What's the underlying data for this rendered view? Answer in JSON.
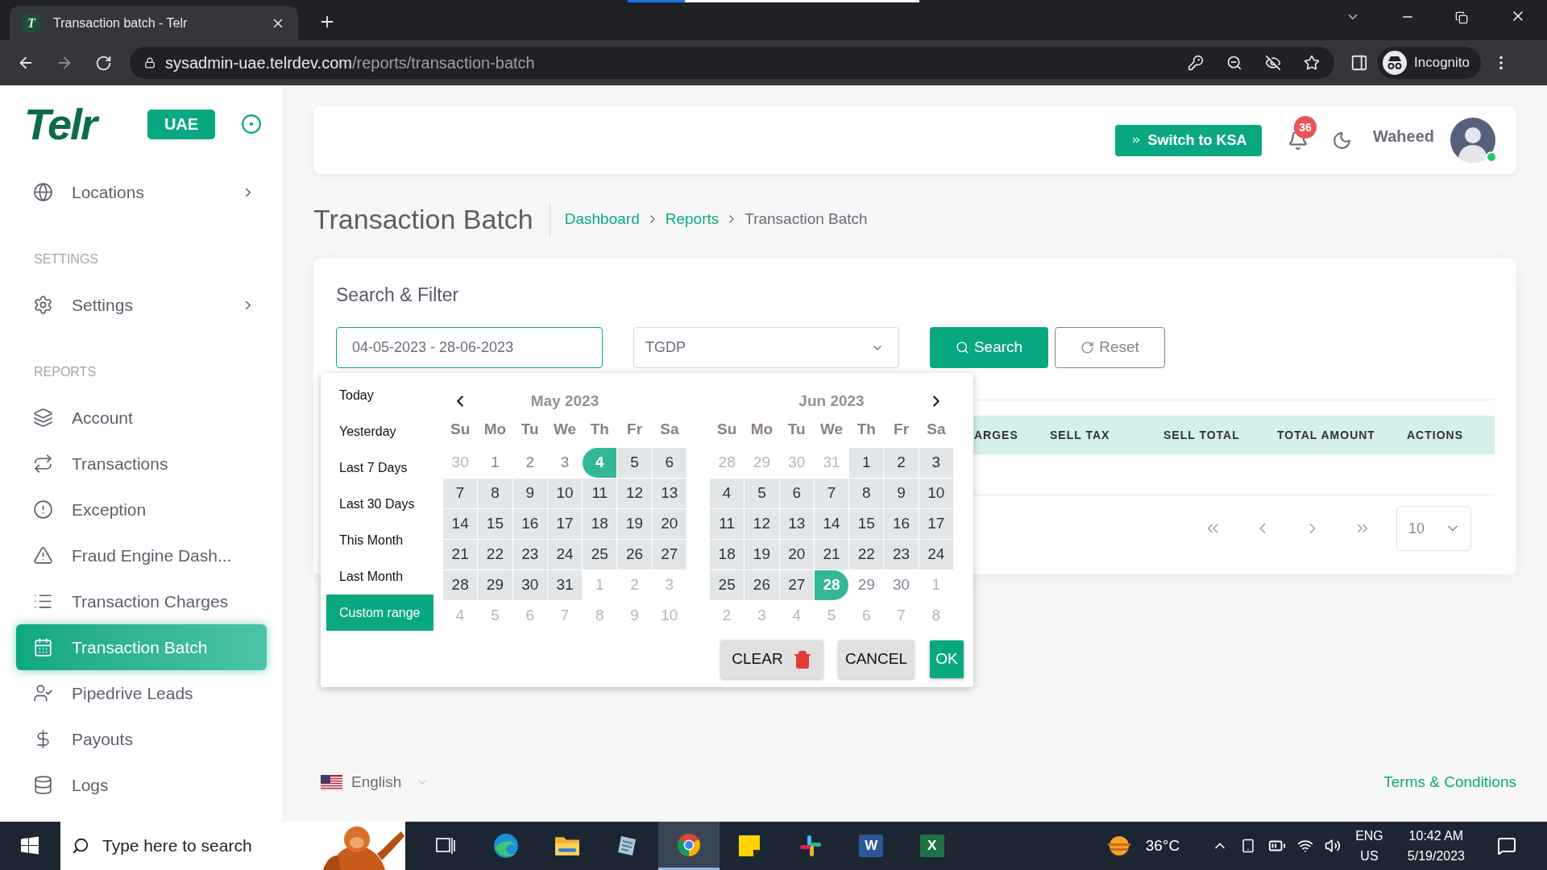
{
  "browser": {
    "tab": {
      "favicon": "T",
      "title": "Transaction batch - Telr"
    },
    "url": {
      "host": "sysadmin-uae.telrdev.com",
      "path": "/reports/transaction-batch"
    },
    "profile": "Incognito"
  },
  "sidebar": {
    "logo": "Telr",
    "region_badge": "UAE",
    "sections": [
      {
        "items": [
          {
            "label": "Locations",
            "has_submenu": true,
            "selected": false
          }
        ]
      },
      {
        "title": "SETTINGS",
        "items": [
          {
            "label": "Settings",
            "has_submenu": true,
            "selected": false
          }
        ]
      },
      {
        "title": "REPORTS",
        "items": [
          {
            "label": "Account",
            "has_submenu": false,
            "selected": false
          },
          {
            "label": "Transactions",
            "has_submenu": false,
            "selected": false
          },
          {
            "label": "Exception",
            "has_submenu": false,
            "selected": false
          },
          {
            "label": "Fraud Engine Dash...",
            "has_submenu": false,
            "selected": false
          },
          {
            "label": "Transaction Charges",
            "has_submenu": false,
            "selected": false
          },
          {
            "label": "Transaction Batch",
            "has_submenu": false,
            "selected": true
          },
          {
            "label": "Pipedrive Leads",
            "has_submenu": false,
            "selected": false
          },
          {
            "label": "Payouts",
            "has_submenu": false,
            "selected": false
          },
          {
            "label": "Logs",
            "has_submenu": false,
            "selected": false
          }
        ]
      }
    ]
  },
  "header": {
    "switch_button": "Switch to KSA",
    "notifications": "36",
    "user": {
      "name": "Waheed",
      "online": true
    }
  },
  "page": {
    "title": "Transaction Batch",
    "breadcrumbs": [
      {
        "label": "Dashboard",
        "current": false
      },
      {
        "label": "Reports",
        "current": false
      },
      {
        "label": "Transaction Batch",
        "current": true
      }
    ]
  },
  "filter": {
    "title": "Search & Filter",
    "date_range": {
      "value": "04-05-2023 - 28-06-2023",
      "focused": true
    },
    "merchant_select": {
      "value": "TGDP"
    },
    "buttons": [
      {
        "label": "Search",
        "kind": "primary"
      },
      {
        "label": "Reset",
        "kind": "secondary"
      }
    ]
  },
  "date_picker": {
    "ranges": [
      {
        "label": "Today",
        "selected": false
      },
      {
        "label": "Yesterday",
        "selected": false
      },
      {
        "label": "Last 7 Days",
        "selected": false
      },
      {
        "label": "Last 30 Days",
        "selected": false
      },
      {
        "label": "This Month",
        "selected": false
      },
      {
        "label": "Last Month",
        "selected": false
      },
      {
        "label": "Custom range",
        "selected": true
      }
    ],
    "months": [
      {
        "title": "May 2023",
        "weekdays": [
          "Su",
          "Mo",
          "Tu",
          "We",
          "Th",
          "Fr",
          "Sa"
        ],
        "days": [
          {
            "day": "30",
            "kind": "off"
          },
          {
            "day": "1",
            "kind": "normal"
          },
          {
            "day": "2",
            "kind": "normal"
          },
          {
            "day": "3",
            "kind": "normal"
          },
          {
            "day": "4",
            "kind": "start"
          },
          {
            "day": "5",
            "kind": "in_range"
          },
          {
            "day": "6",
            "kind": "in_range"
          },
          {
            "day": "7",
            "kind": "in_range"
          },
          {
            "day": "8",
            "kind": "in_range"
          },
          {
            "day": "9",
            "kind": "in_range"
          },
          {
            "day": "10",
            "kind": "in_range"
          },
          {
            "day": "11",
            "kind": "in_range"
          },
          {
            "day": "12",
            "kind": "in_range"
          },
          {
            "day": "13",
            "kind": "in_range"
          },
          {
            "day": "14",
            "kind": "in_range"
          },
          {
            "day": "15",
            "kind": "in_range"
          },
          {
            "day": "16",
            "kind": "in_range"
          },
          {
            "day": "17",
            "kind": "in_range"
          },
          {
            "day": "18",
            "kind": "in_range"
          },
          {
            "day": "19",
            "kind": "in_range"
          },
          {
            "day": "20",
            "kind": "in_range"
          },
          {
            "day": "21",
            "kind": "in_range"
          },
          {
            "day": "22",
            "kind": "in_range"
          },
          {
            "day": "23",
            "kind": "in_range"
          },
          {
            "day": "24",
            "kind": "in_range"
          },
          {
            "day": "25",
            "kind": "in_range"
          },
          {
            "day": "26",
            "kind": "in_range"
          },
          {
            "day": "27",
            "kind": "in_range"
          },
          {
            "day": "28",
            "kind": "in_range"
          },
          {
            "day": "29",
            "kind": "in_range"
          },
          {
            "day": "30",
            "kind": "in_range"
          },
          {
            "day": "31",
            "kind": "in_range"
          },
          {
            "day": "1",
            "kind": "off"
          },
          {
            "day": "2",
            "kind": "off"
          },
          {
            "day": "3",
            "kind": "off"
          },
          {
            "day": "4",
            "kind": "off"
          },
          {
            "day": "5",
            "kind": "off"
          },
          {
            "day": "6",
            "kind": "off"
          },
          {
            "day": "7",
            "kind": "off"
          },
          {
            "day": "8",
            "kind": "off"
          },
          {
            "day": "9",
            "kind": "off"
          },
          {
            "day": "10",
            "kind": "off"
          }
        ]
      },
      {
        "title": "Jun 2023",
        "weekdays": [
          "Su",
          "Mo",
          "Tu",
          "We",
          "Th",
          "Fr",
          "Sa"
        ],
        "days": [
          {
            "day": "28",
            "kind": "off"
          },
          {
            "day": "29",
            "kind": "off"
          },
          {
            "day": "30",
            "kind": "off"
          },
          {
            "day": "31",
            "kind": "off"
          },
          {
            "day": "1",
            "kind": "in_range"
          },
          {
            "day": "2",
            "kind": "in_range"
          },
          {
            "day": "3",
            "kind": "in_range"
          },
          {
            "day": "4",
            "kind": "in_range"
          },
          {
            "day": "5",
            "kind": "in_range"
          },
          {
            "day": "6",
            "kind": "in_range"
          },
          {
            "day": "7",
            "kind": "in_range"
          },
          {
            "day": "8",
            "kind": "in_range"
          },
          {
            "day": "9",
            "kind": "in_range"
          },
          {
            "day": "10",
            "kind": "in_range"
          },
          {
            "day": "11",
            "kind": "in_range"
          },
          {
            "day": "12",
            "kind": "in_range"
          },
          {
            "day": "13",
            "kind": "in_range"
          },
          {
            "day": "14",
            "kind": "in_range"
          },
          {
            "day": "15",
            "kind": "in_range"
          },
          {
            "day": "16",
            "kind": "in_range"
          },
          {
            "day": "17",
            "kind": "in_range"
          },
          {
            "day": "18",
            "kind": "in_range"
          },
          {
            "day": "19",
            "kind": "in_range"
          },
          {
            "day": "20",
            "kind": "in_range"
          },
          {
            "day": "21",
            "kind": "in_range"
          },
          {
            "day": "22",
            "kind": "in_range"
          },
          {
            "day": "23",
            "kind": "in_range"
          },
          {
            "day": "24",
            "kind": "in_range"
          },
          {
            "day": "25",
            "kind": "in_range"
          },
          {
            "day": "26",
            "kind": "in_range"
          },
          {
            "day": "27",
            "kind": "in_range"
          },
          {
            "day": "28",
            "kind": "end"
          },
          {
            "day": "29",
            "kind": "normal"
          },
          {
            "day": "30",
            "kind": "normal"
          },
          {
            "day": "1",
            "kind": "off"
          },
          {
            "day": "2",
            "kind": "off"
          },
          {
            "day": "3",
            "kind": "off"
          },
          {
            "day": "4",
            "kind": "off"
          },
          {
            "day": "5",
            "kind": "off"
          },
          {
            "day": "6",
            "kind": "off"
          },
          {
            "day": "7",
            "kind": "off"
          },
          {
            "day": "8",
            "kind": "off"
          }
        ]
      }
    ],
    "buttons": [
      {
        "label": "CLEAR",
        "kind": "clear"
      },
      {
        "label": "CANCEL",
        "kind": "cancel"
      },
      {
        "label": "OK",
        "kind": "ok"
      }
    ]
  },
  "table": {
    "columns": [
      "ARGES",
      "SELL TAX",
      "SELL TOTAL",
      "TOTAL AMOUNT",
      "ACTIONS"
    ]
  },
  "pagination": {
    "page_size": "10"
  },
  "footer": {
    "language": "English",
    "terms": "Terms & Conditions"
  },
  "taskbar": {
    "search_placeholder": "Type here to search",
    "apps": [
      {
        "kind": "taskview",
        "selected": false
      },
      {
        "kind": "edge",
        "selected": false
      },
      {
        "kind": "explorer",
        "selected": false
      },
      {
        "kind": "notepad",
        "selected": false
      },
      {
        "kind": "chrome",
        "selected": true
      },
      {
        "kind": "sticky",
        "selected": false
      },
      {
        "kind": "slack",
        "selected": false
      },
      {
        "kind": "word",
        "letter": "W",
        "selected": false
      },
      {
        "kind": "excel",
        "letter": "X",
        "selected": false
      }
    ],
    "weather": "36°C",
    "language": "ENG",
    "region": "US",
    "time": "10:42 AM",
    "date": "5/19/2023"
  }
}
